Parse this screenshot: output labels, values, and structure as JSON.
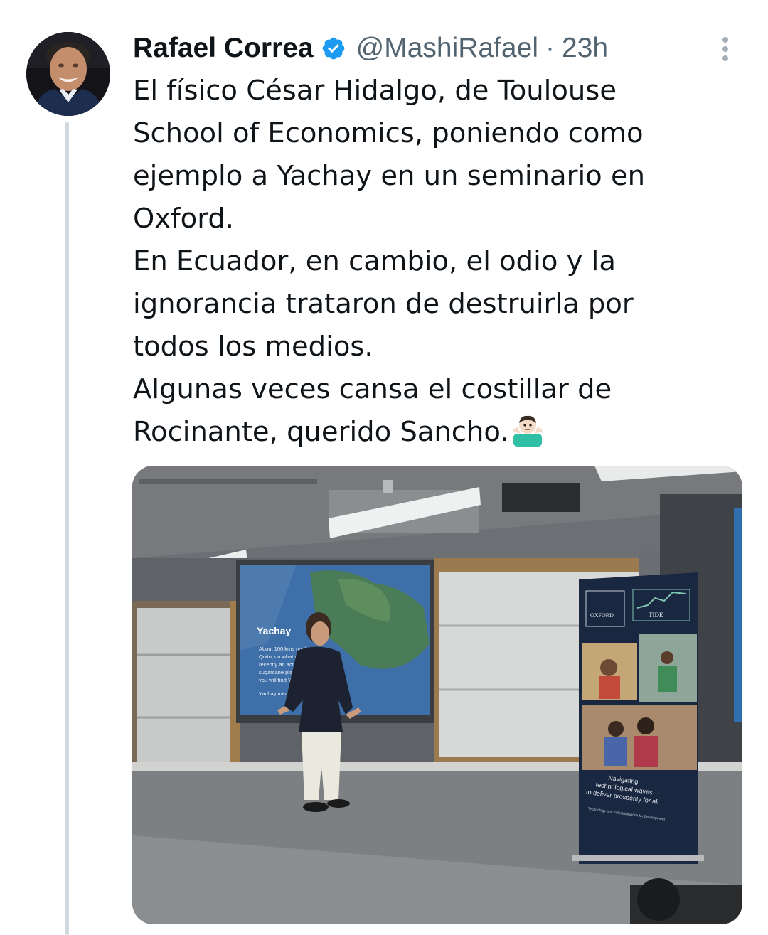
{
  "tweet": {
    "author": {
      "display_name": "Rafael Correa",
      "handle": "@MashiRafael",
      "verified": true,
      "avatar_icon": "profile-photo"
    },
    "separator": "·",
    "timestamp": "23h",
    "text_lines": [
      "El físico César Hidalgo, de Toulouse",
      "School of Economics, poniendo como",
      "ejemplo a Yachay en un seminario en",
      "Oxford.",
      "En Ecuador, en cambio, el odio y la",
      "ignorancia trataron de destruirla por",
      "todos los medios.",
      "Algunas veces cansa el costillar de",
      "Rocinante, querido Sancho."
    ],
    "emoji": "man-shrugging-emoji",
    "media": {
      "slide_title": "Yachay",
      "slide_body": [
        "About 100 kms north of",
        "Quito, on what was until",
        "recently an active",
        "sugarcane plantation,",
        "you will find Yachay"
      ],
      "slide_footer": "Yachay means...",
      "banner_logo_left": "OXFORD",
      "banner_logo_right": "TIDE",
      "banner_tagline": [
        "Navigating",
        "technological waves",
        "to deliver prosperity for all"
      ],
      "banner_subtitle": "Technology and Industrialisation for Development"
    },
    "colors": {
      "verified_badge": "#1d9bf0",
      "thread_line": "#cfd9de",
      "secondary_text": "#536471",
      "primary_text": "#0f1419"
    }
  }
}
